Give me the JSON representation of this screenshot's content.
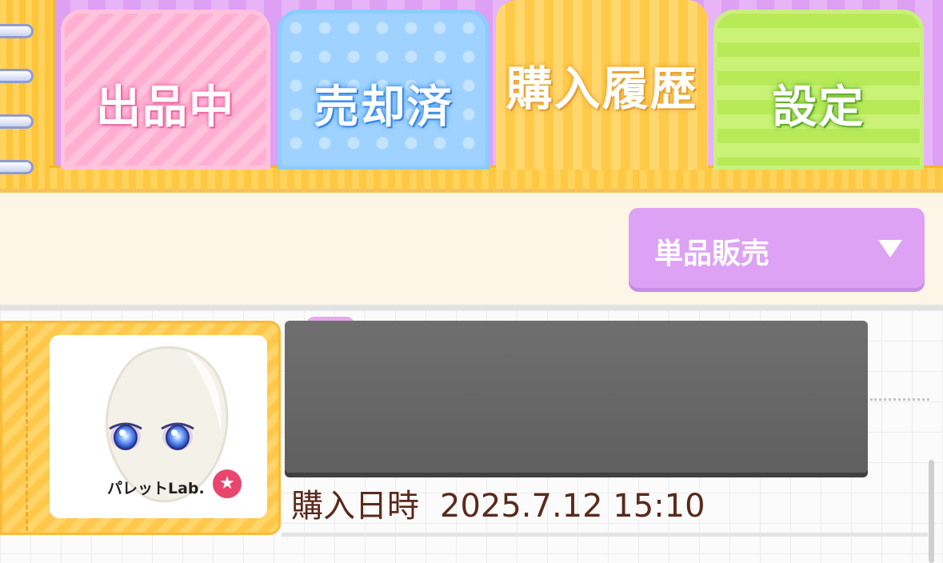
{
  "tabs": [
    {
      "label": "出品中",
      "color": "#ffb0d2"
    },
    {
      "label": "売却済",
      "color": "#9fd2ff"
    },
    {
      "label": "購入履歴",
      "color": "#ffca4a",
      "active": true
    },
    {
      "label": "設定",
      "color": "#b8ea58"
    }
  ],
  "filter": {
    "selected": "単品販売"
  },
  "items": [
    {
      "brand": "パレットLab.",
      "purchase_label": "購入日時",
      "purchase_datetime": "2025.7.12 15:10",
      "name_redacted": true,
      "thumbnail_icon": "avatar-face-icon"
    }
  ],
  "colors": {
    "accent_purple": "#dda2f4",
    "text_brown": "#5a2a1b",
    "badge_red": "#e8466f"
  }
}
